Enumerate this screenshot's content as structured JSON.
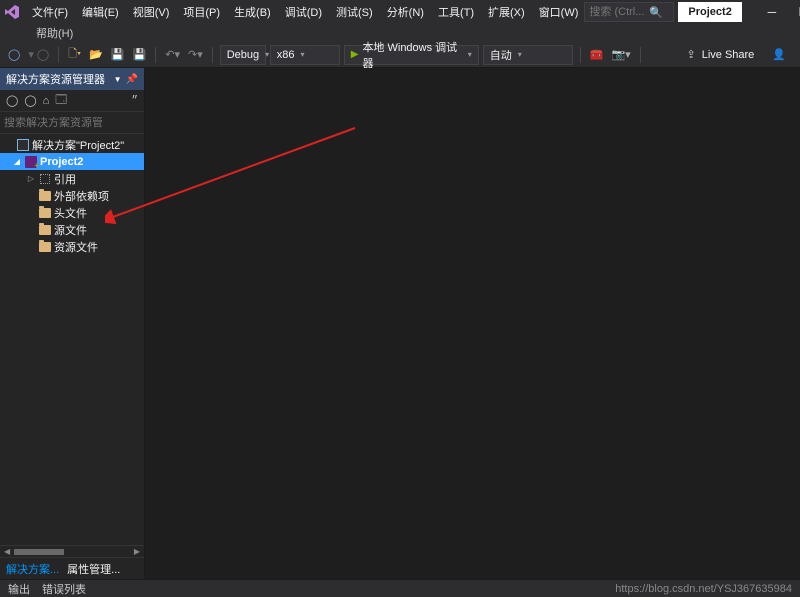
{
  "title": {
    "menu": [
      "文件(F)",
      "编辑(E)",
      "视图(V)",
      "项目(P)",
      "生成(B)",
      "调试(D)",
      "测试(S)",
      "分析(N)",
      "工具(T)",
      "扩展(X)",
      "窗口(W)"
    ],
    "menu2": "帮助(H)",
    "search_placeholder": "搜索 (Ctrl...",
    "project": "Project2"
  },
  "toolbar": {
    "config": "Debug",
    "platform": "x86",
    "debugger": "本地 Windows 调试器",
    "auto": "自动",
    "liveshare": "Live Share"
  },
  "side": {
    "title": "解决方案资源管理器",
    "search_placeholder": "搜索解决方案资源管",
    "tree": {
      "solution": "解决方案\"Project2\"",
      "project": "Project2",
      "nodes": [
        {
          "label": "引用",
          "kind": "ref"
        },
        {
          "label": "外部依赖项",
          "kind": "folder"
        },
        {
          "label": "头文件",
          "kind": "folder"
        },
        {
          "label": "源文件",
          "kind": "folder"
        },
        {
          "label": "资源文件",
          "kind": "folder"
        }
      ]
    },
    "tabs": {
      "active": "解决方案...",
      "other": "属性管理..."
    }
  },
  "status": {
    "left1": "输出",
    "left2": "错误列表",
    "right": "https://blog.csdn.net/YSJ367635984"
  }
}
